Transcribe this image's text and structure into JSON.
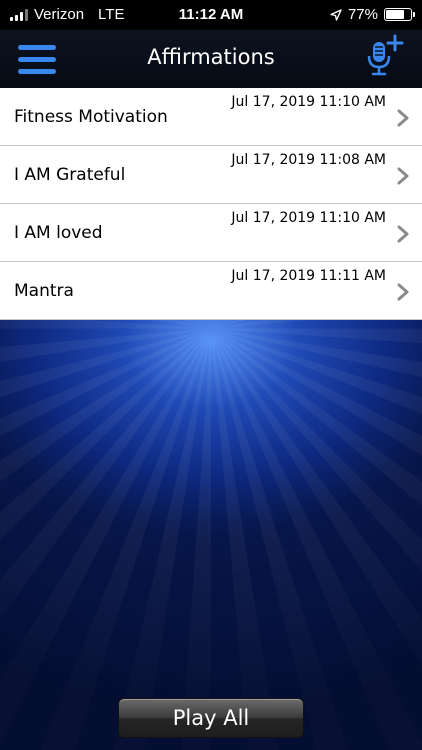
{
  "status_bar": {
    "carrier": "Verizon",
    "network": "LTE",
    "time": "11:12 AM",
    "battery_percent": "77%",
    "battery_level": 0.77
  },
  "nav": {
    "title": "Affirmations",
    "menu_icon": "hamburger-icon",
    "record_icon": "microphone-plus-icon",
    "accent_color": "#3a86ef"
  },
  "affirmations": [
    {
      "title": "Fitness Motivation",
      "date": "Jul 17, 2019 11:10 AM"
    },
    {
      "title": "I AM Grateful",
      "date": "Jul 17, 2019 11:08 AM"
    },
    {
      "title": "I AM loved",
      "date": "Jul 17, 2019 11:10 AM"
    },
    {
      "title": "Mantra",
      "date": "Jul 17, 2019 11:11 AM"
    }
  ],
  "footer": {
    "play_all_label": "Play All"
  }
}
